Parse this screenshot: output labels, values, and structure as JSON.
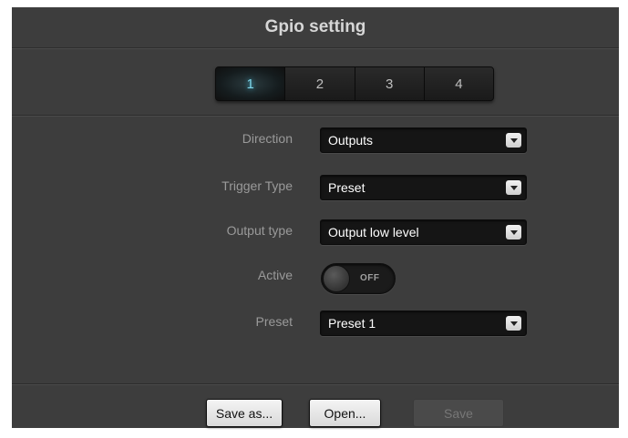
{
  "dialog": {
    "title": "Gpio setting"
  },
  "tabs": [
    {
      "label": "1",
      "active": true
    },
    {
      "label": "2",
      "active": false
    },
    {
      "label": "3",
      "active": false
    },
    {
      "label": "4",
      "active": false
    }
  ],
  "fields": {
    "direction": {
      "label": "Direction",
      "value": "Outputs"
    },
    "trigger_type": {
      "label": "Trigger Type",
      "value": "Preset"
    },
    "output_type": {
      "label": "Output type",
      "value": "Output low level"
    },
    "active": {
      "label": "Active",
      "state": "OFF"
    },
    "preset": {
      "label": "Preset",
      "value": "Preset 1"
    }
  },
  "buttons": {
    "save_as": "Save as...",
    "open": "Open...",
    "save": "Save"
  },
  "colors": {
    "background": "#3d3d3d",
    "active_tab_text": "#7fd6ea",
    "select_bg": "#151515"
  },
  "icons": {
    "dropdown": "chevron-down-icon"
  }
}
